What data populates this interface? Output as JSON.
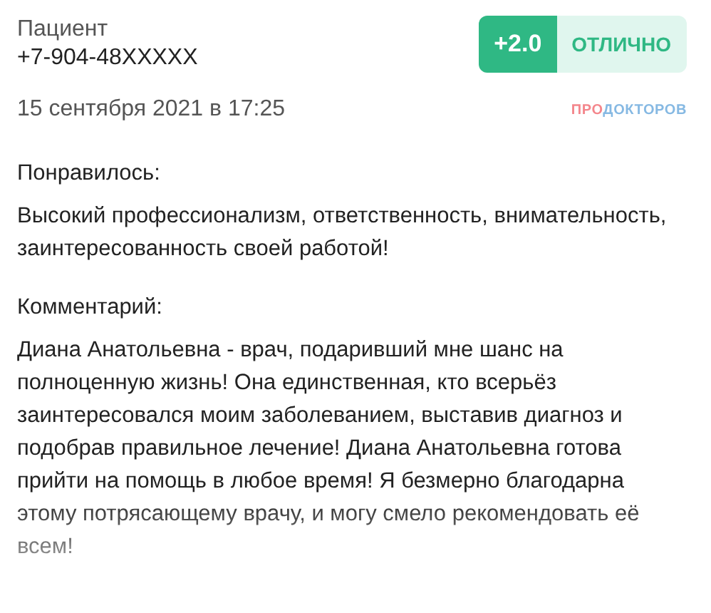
{
  "author": {
    "label": "Пациент",
    "phone": "+7-904-48XXXXX"
  },
  "rating": {
    "score": "+2.0",
    "label": "ОТЛИЧНО"
  },
  "date": "15 сентября 2021 в 17:25",
  "logo": [
    {
      "text": "ПРО",
      "color": "#f4868c"
    },
    {
      "text": "ДОКТОРОВ",
      "color": "#86b9e3"
    }
  ],
  "sections": [
    {
      "title": "Понравилось:",
      "text": "Высокий профессионализм, ответственность, внимательность, заинтересованность своей работой!",
      "faded": false
    },
    {
      "title": "Комментарий:",
      "text": "Диана Анатольевна - врач, подаривший мне шанс на полноценную жизнь! Она единственная, кто всерьёз заинтересовался моим заболеванием, выставив диагноз и подобрав правильное лечение! Диана Анатольевна готова прийти на помощь в любое время! Я безмерно благодарна этому потрясающему врачу, и могу смело рекомендовать её всем!",
      "faded": true
    }
  ]
}
